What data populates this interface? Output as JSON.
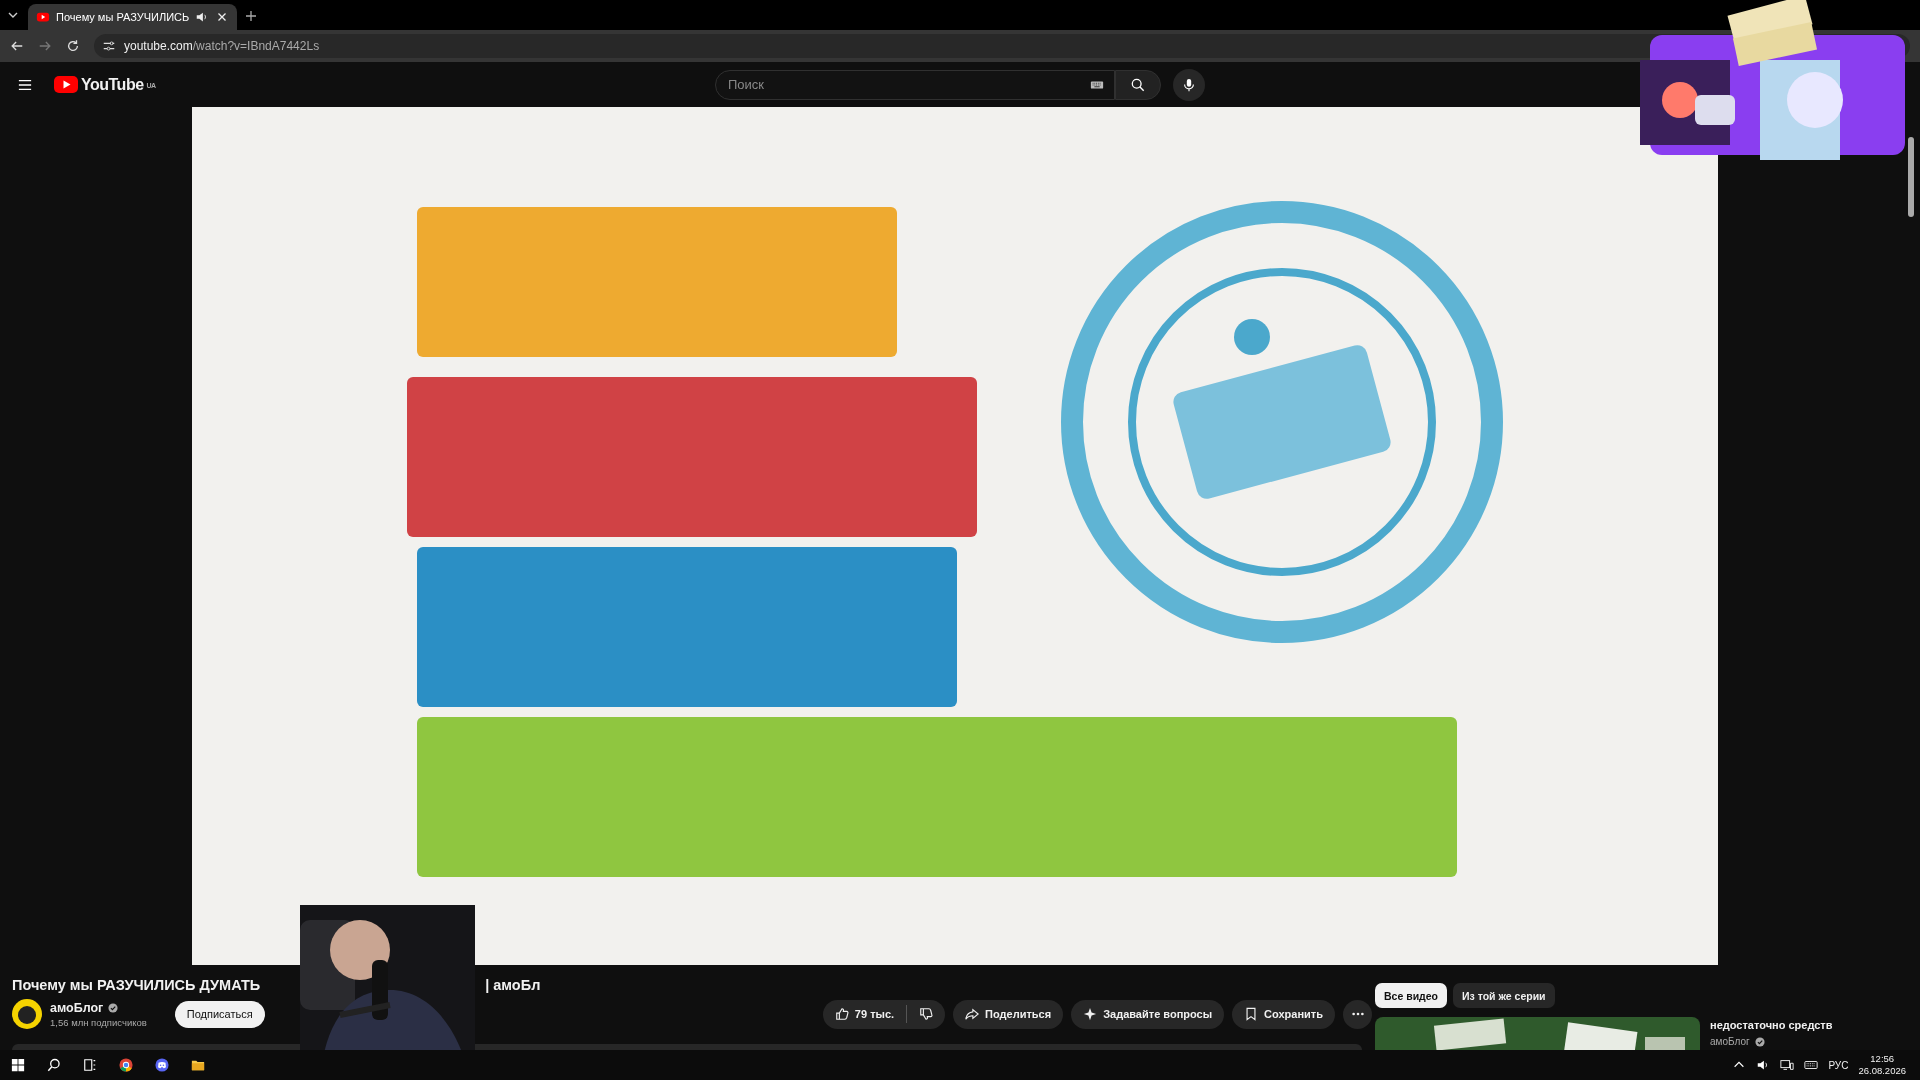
{
  "browser": {
    "tab": {
      "title": "Почему мы РАЗУЧИЛИСЬ",
      "selected": true
    },
    "address_host": "youtube.com",
    "address_path": "/watch?v=IBndA7442Ls"
  },
  "header": {
    "logo": "YouTube",
    "region": "UA",
    "search": {
      "placeholder": "Поиск"
    }
  },
  "info": {
    "title": "Почему мы РАЗУЧИЛИСЬ ДУМАТЬ",
    "title_tail": "| амоБл",
    "channel": {
      "name": "амоБлог",
      "subscribers": "1,56 млн подписчиков",
      "verified": true
    },
    "subscribe": "Подписаться",
    "actions": [
      {
        "kind": "like",
        "label": "79 тыс."
      },
      {
        "kind": "share",
        "label": "Поделиться"
      },
      {
        "kind": "ask",
        "label": "Задавайте вопросы"
      },
      {
        "kind": "save",
        "label": "Сохранить"
      },
      {
        "kind": "more"
      }
    ]
  },
  "chips": [
    {
      "label": "Все видео",
      "selected": true
    },
    {
      "label": "Из той же серии",
      "selected": false
    }
  ],
  "recommendation": {
    "title": "недостаточно средств",
    "channel": "амоБлог",
    "verified": true
  },
  "taskbar": {
    "apps": [
      {
        "kind": "start"
      },
      {
        "kind": "search"
      },
      {
        "kind": "taskview"
      },
      {
        "kind": "chrome"
      },
      {
        "kind": "discord"
      },
      {
        "kind": "explorer"
      }
    ],
    "language": "РУС",
    "time": "12:56",
    "date": "26.08.2026"
  }
}
